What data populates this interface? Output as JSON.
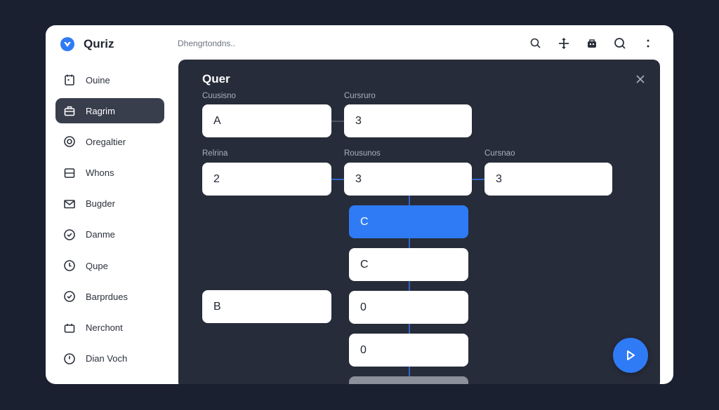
{
  "app": {
    "title": "Quriz",
    "brand_color": "#2f7bf5"
  },
  "header": {
    "breadcrumb": "Dhengrtondns..",
    "icons": [
      "search-icon",
      "move-icon",
      "bag-icon",
      "search-large-icon",
      "more-vertical-icon"
    ]
  },
  "sidebar": {
    "items": [
      {
        "label": "Ouine",
        "icon": "calendar-icon",
        "active": false
      },
      {
        "label": "Ragrim",
        "icon": "briefcase-icon",
        "active": true
      },
      {
        "label": "Oregaltier",
        "icon": "circle-target-icon",
        "active": false
      },
      {
        "label": "Whons",
        "icon": "list-icon",
        "active": false
      },
      {
        "label": "Bugder",
        "icon": "mail-icon",
        "active": false
      },
      {
        "label": "Danme",
        "icon": "check-circle-icon",
        "active": false
      },
      {
        "label": "Qupe",
        "icon": "clock-icon",
        "active": false
      },
      {
        "label": "Barprdues",
        "icon": "check-circle-icon",
        "active": false
      },
      {
        "label": "Nerchont",
        "icon": "box-icon",
        "active": false
      },
      {
        "label": "Dian Voch",
        "icon": "clock-icon",
        "active": false
      }
    ]
  },
  "panel": {
    "title": "Quer",
    "labels": {
      "row1_left": "Cuusisno",
      "row1_mid": "Cursruro",
      "row2_left": "Relrina",
      "row2_mid": "Rousunos",
      "row2_right": "Cursnao"
    },
    "cards": {
      "r1_left": "A",
      "r1_mid": "3",
      "r2_left": "2",
      "r2_mid": "3",
      "r2_right": "3",
      "col_c1": "C",
      "col_c2": "C",
      "left_b": "B",
      "col_o1": "0",
      "col_o2": "0"
    }
  },
  "actions": {
    "play_icon": "play-icon"
  }
}
